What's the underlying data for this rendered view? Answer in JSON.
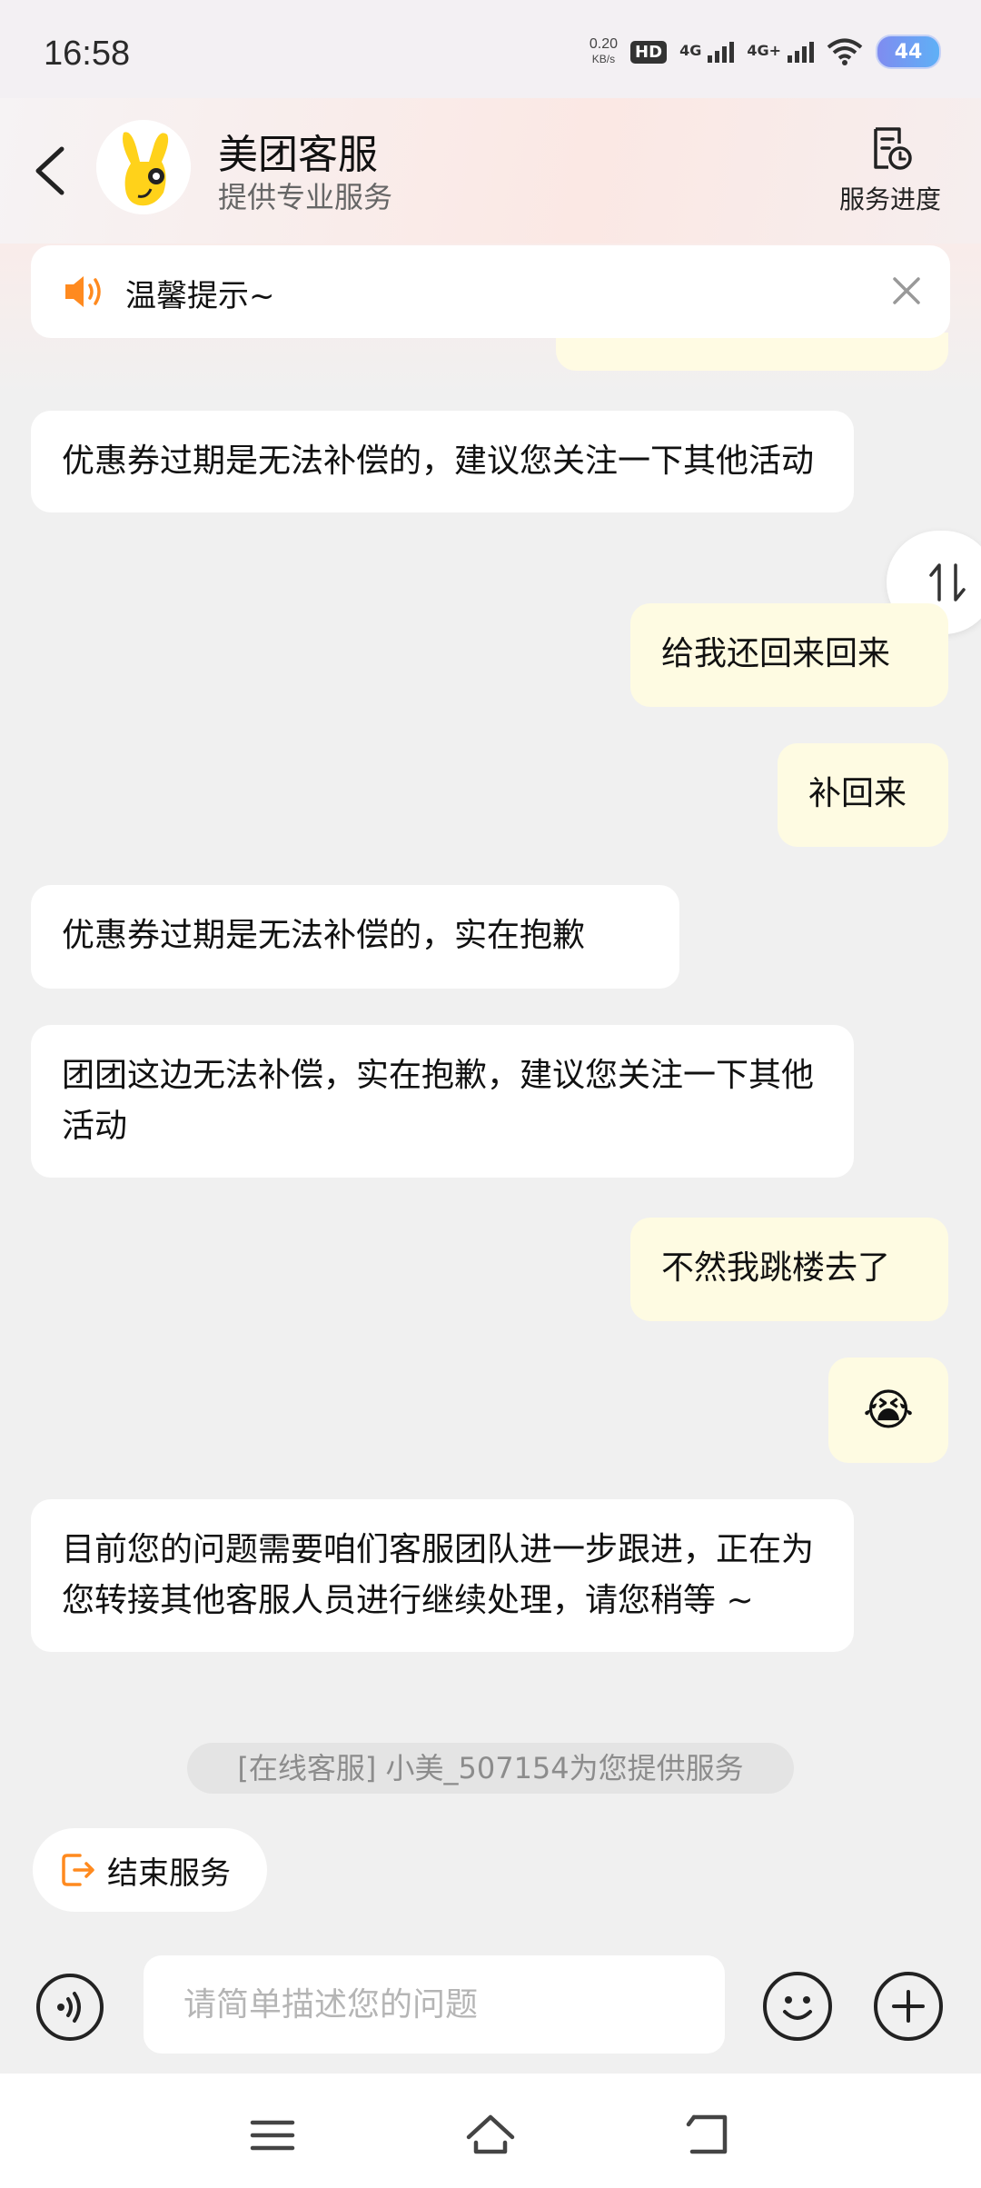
{
  "status_bar": {
    "time": "16:58",
    "net_speed_value": "0.20",
    "net_speed_unit": "KB/s",
    "hd": "HD",
    "sim1_label": "4G",
    "sim2_label": "4G+",
    "battery": "44"
  },
  "header": {
    "title": "美团客服",
    "subtitle": "提供专业服务",
    "progress_label": "服务进度"
  },
  "notice": {
    "text": "温馨提示~"
  },
  "messages": [
    {
      "side": "in",
      "text": "优惠券过期是无法补偿的，建议您关注一下其他活动"
    },
    {
      "side": "out",
      "text": "给我还回来回来"
    },
    {
      "side": "out",
      "text": "补回来"
    },
    {
      "side": "in",
      "text": "优惠券过期是无法补偿的，实在抱歉"
    },
    {
      "side": "in",
      "text": "团团这边无法补偿，实在抱歉，建议您关注一下其他活动"
    },
    {
      "side": "out",
      "text": "不然我跳楼去了"
    },
    {
      "side": "out",
      "text": "😭"
    },
    {
      "side": "in",
      "text": "目前您的问题需要咱们客服团队进一步跟进，正在为您转接其他客服人员进行继续处理，请您稍等 ~"
    }
  ],
  "system_message": "[在线客服] 小美_507154为您提供服务",
  "quick_action": {
    "label": "结束服务"
  },
  "composer": {
    "placeholder": "请简单描述您的问题",
    "value": ""
  },
  "colors": {
    "incoming_bubble": "#ffffff",
    "outgoing_bubble": "#fefbe2",
    "accent": "#ff8a1f",
    "background": "#f0f0f0"
  }
}
